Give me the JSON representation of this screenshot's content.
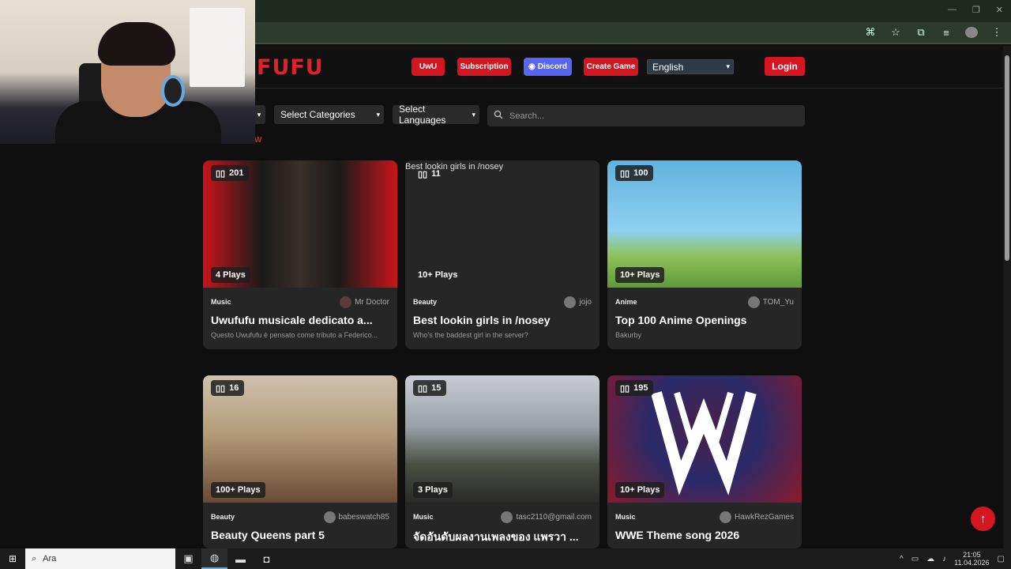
{
  "browser": {
    "window_controls": [
      "—",
      "❐",
      "✕"
    ]
  },
  "site": {
    "logo": "FUFU",
    "nav": {
      "uwu": "UwU",
      "subscription": "Subscription",
      "discord": "Discord",
      "create_game": "Create Game",
      "language": "English",
      "login": "Login"
    },
    "filters": {
      "categories": "Select Categories",
      "languages": "Select Languages",
      "search_placeholder": "Search..."
    },
    "partial_label": "W"
  },
  "cards": [
    {
      "count": "201",
      "plays": "4 Plays",
      "category": "Music",
      "author": "Mr Doctor",
      "title": "Uwufufu musicale dedicato a...",
      "desc": "Questo Uwufufu è pensato come tributo a Federico..."
    },
    {
      "count": "11",
      "plays": "10+ Plays",
      "category": "Beauty",
      "author": "jojo",
      "title": "Best lookin girls in /nosey",
      "desc": "Who's the baddest girl in the server?",
      "alt": "Best lookin girls in /nosey"
    },
    {
      "count": "100",
      "plays": "10+ Plays",
      "category": "Anime",
      "author": "TOM_Yu",
      "title": "Top 100 Anime Openings",
      "desc": "Bakurby"
    },
    {
      "count": "16",
      "plays": "100+ Plays",
      "category": "Beauty",
      "author": "babeswatch85",
      "title": "Beauty Queens part 5",
      "desc": ""
    },
    {
      "count": "15",
      "plays": "3 Plays",
      "category": "Music",
      "author": "tasc2110@gmail.com",
      "title": "จัดอันดับผลงานเพลงของ แพรวา ...",
      "desc": ""
    },
    {
      "count": "195",
      "plays": "10+ Plays",
      "category": "Music",
      "author": "HawkRezGames",
      "title": "WWE Theme song 2026",
      "desc": ""
    }
  ],
  "taskbar": {
    "search": "Ara",
    "time": "21:05",
    "date": "11.04.2026"
  },
  "colors": {
    "brand_red": "#d5151f",
    "discord": "#5865f2"
  }
}
